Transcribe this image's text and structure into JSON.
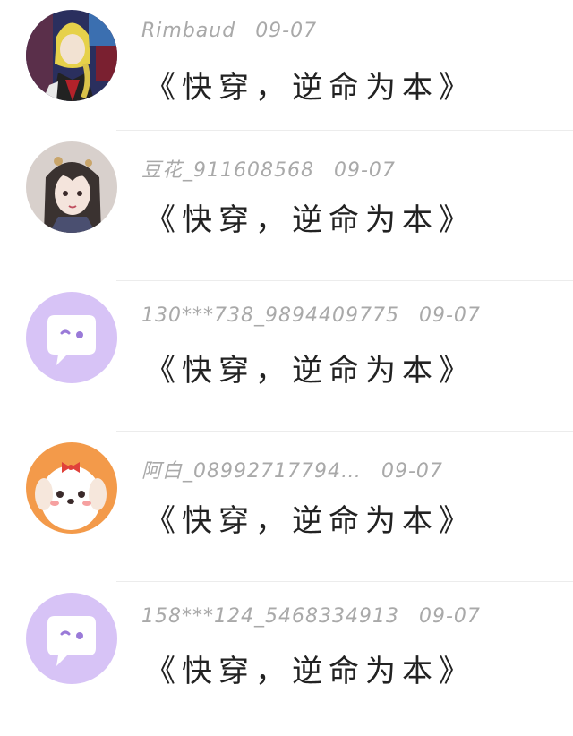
{
  "comments": [
    {
      "username": "Rimbaud",
      "date": "09-07",
      "text": "《快穿，逆命为本》",
      "avatar": "anime-boy-avatar"
    },
    {
      "username": "豆花_911608568",
      "date": "09-07",
      "text": "《快穿，逆命为本》",
      "avatar": "anime-girl-avatar"
    },
    {
      "username": "130***738_9894409775",
      "date": "09-07",
      "text": "《快穿，逆命为本》",
      "avatar": "default-chat-avatar"
    },
    {
      "username": "阿白_08992717794…",
      "date": "09-07",
      "text": "《快穿，逆命为本》",
      "avatar": "puppy-avatar"
    },
    {
      "username": "158***124_5468334913",
      "date": "09-07",
      "text": "《快穿，逆命为本》",
      "avatar": "default-chat-avatar"
    }
  ],
  "colors": {
    "default_avatar": "#d7c3f6",
    "username": "#a9a9a9",
    "divider": "#ececec"
  }
}
